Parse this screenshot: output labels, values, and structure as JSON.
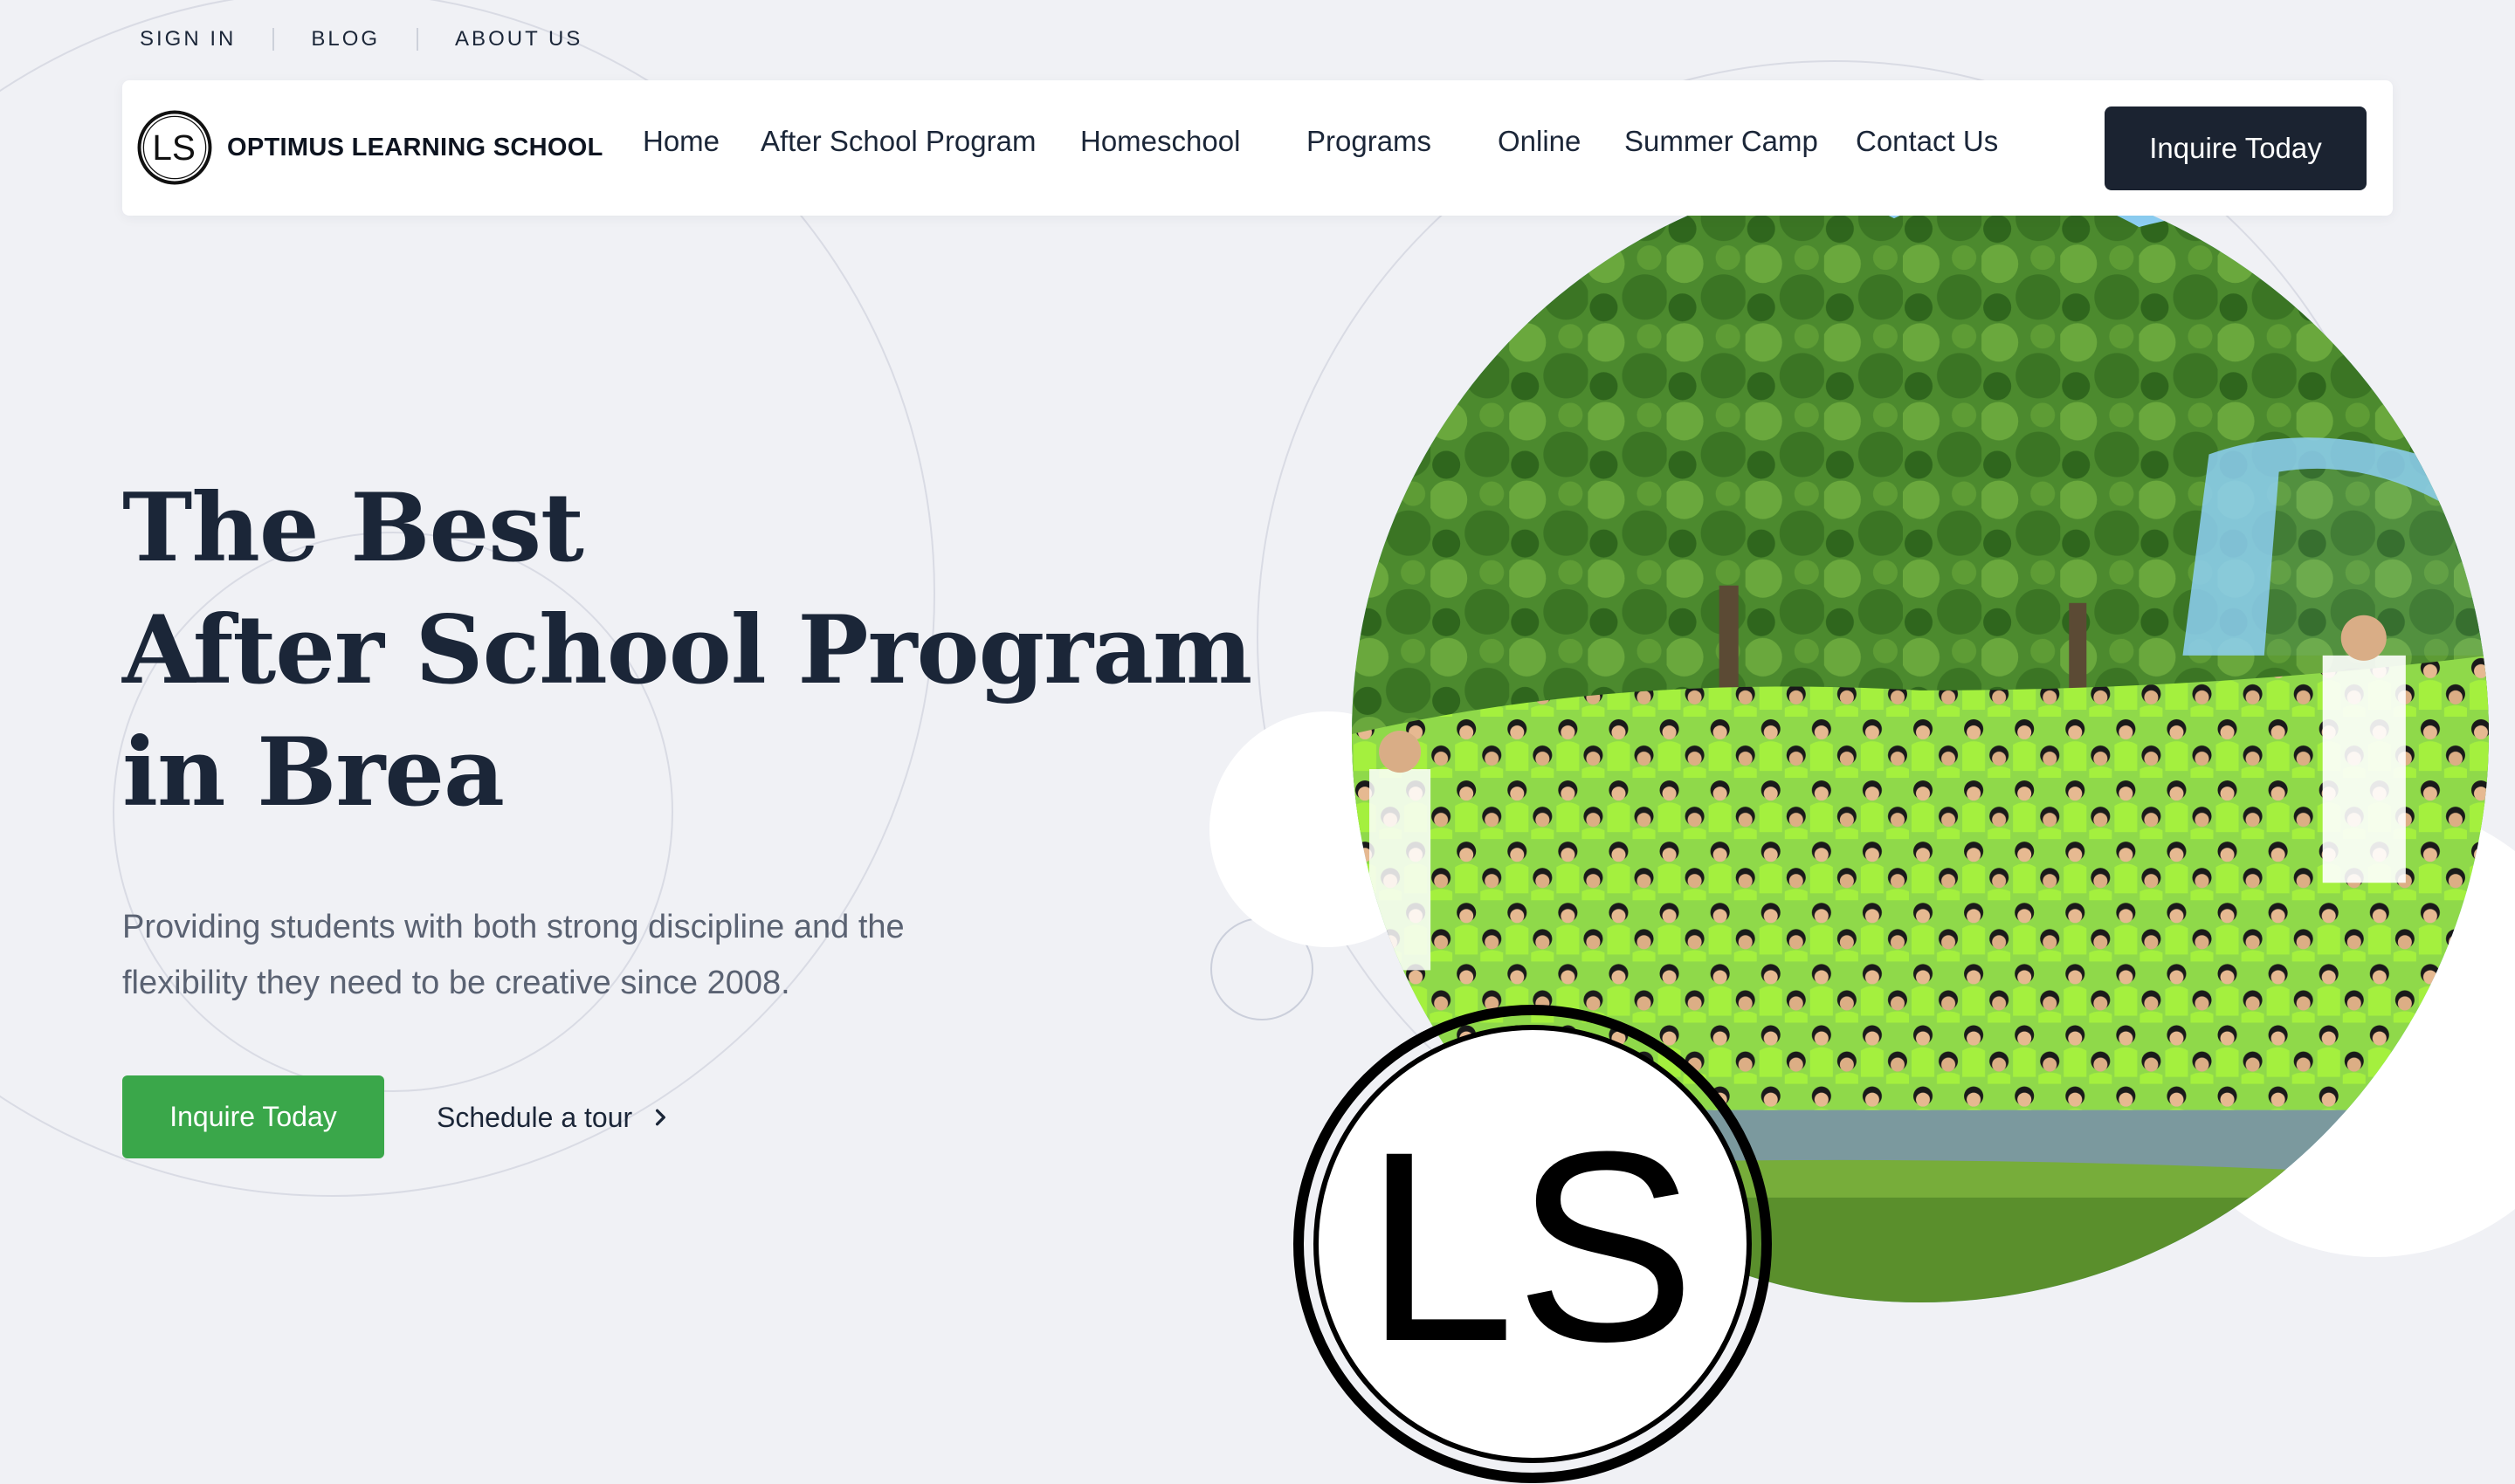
{
  "utility_nav": {
    "links": [
      {
        "label": "SIGN IN"
      },
      {
        "label": "BLOG"
      },
      {
        "label": "ABOUT US"
      }
    ]
  },
  "brand": {
    "logo_text": "LS",
    "name": "OPTIMUS LEARNING SCHOOL"
  },
  "main_nav": {
    "items": [
      {
        "label": "Home"
      },
      {
        "label": "After School Program"
      },
      {
        "label": "Homeschool"
      },
      {
        "label": "Programs"
      },
      {
        "label": "Online"
      },
      {
        "label": "Summer Camp"
      },
      {
        "label": "Contact Us"
      }
    ],
    "cta_label": "Inquire Today"
  },
  "hero": {
    "title_lines": [
      "The Best",
      "After School Program",
      "in Brea"
    ],
    "subtitle_lines": [
      "Providing students with both strong discipline and the",
      "flexibility they need to be creative since 2008."
    ],
    "primary_cta_label": "Inquire Today",
    "secondary_link_label": "Schedule a tour",
    "image_logo_text": "LS"
  },
  "colors": {
    "page_background": "#f0f1f5",
    "text_dark": "#1b2638",
    "nav_cta_background": "#1b2331",
    "hero_cta_green": "#3aa74a",
    "shirt_green": "#9bea3a",
    "sky_blue": "#8ed0f4",
    "tree_green": "#3f7d28"
  },
  "icons": {
    "chevron": "chevron-right-icon",
    "logo": "ls-logo-icon"
  }
}
